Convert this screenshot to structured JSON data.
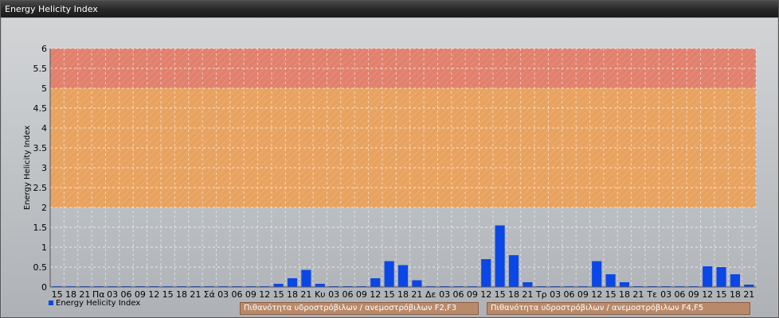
{
  "window": {
    "title": "Energy Helicity Index"
  },
  "legend": {
    "label": "Energy Helicity Index",
    "color": "#0a47e6"
  },
  "bands": [
    {
      "label": "Πιθανότητα υδροστρόβιλων / ανεμοστρόβιλων F2,F3",
      "from": 2,
      "to": 5,
      "color": "#e8a25f"
    },
    {
      "label": "Πιθανότητα υδροστρόβιλων / ανεμοστρόβιλων F4,F5",
      "from": 5,
      "to": 6,
      "color": "#e1806c"
    }
  ],
  "chart_data": {
    "type": "bar",
    "title": "",
    "xlabel": "",
    "ylabel": "Energy Helicity Index",
    "ylim": [
      0,
      6
    ],
    "yticks": [
      "0",
      "0.5",
      "1",
      "1.5",
      "2",
      "2.5",
      "3",
      "3.5",
      "4",
      "4.5",
      "5",
      "5.5",
      "6"
    ],
    "grid": true,
    "categories": [
      "15",
      "18",
      "21",
      "Πα",
      "03",
      "06",
      "09",
      "12",
      "15",
      "18",
      "21",
      "Σά",
      "03",
      "06",
      "09",
      "12",
      "15",
      "18",
      "21",
      "Κυ",
      "03",
      "06",
      "09",
      "12",
      "15",
      "18",
      "21",
      "Δε",
      "03",
      "06",
      "09",
      "12",
      "15",
      "18",
      "21",
      "Τρ",
      "03",
      "06",
      "09",
      "12",
      "15",
      "18",
      "21",
      "Τε",
      "03",
      "06",
      "09",
      "12",
      "15",
      "18",
      "21"
    ],
    "series": [
      {
        "name": "Energy Helicity Index",
        "values": [
          0,
          0,
          0,
          0,
          0,
          0,
          0,
          0,
          0,
          0,
          0,
          0,
          0,
          0,
          0,
          0.02,
          0.08,
          0.22,
          0.43,
          0.08,
          0,
          0,
          0,
          0.22,
          0.65,
          0.55,
          0.17,
          0,
          0,
          0,
          0,
          0.7,
          1.55,
          0.8,
          0.12,
          0,
          0,
          0,
          0,
          0.65,
          0.32,
          0.12,
          0,
          0,
          0,
          0,
          0,
          0.52,
          0.5,
          0.32,
          0.06
        ]
      }
    ]
  }
}
